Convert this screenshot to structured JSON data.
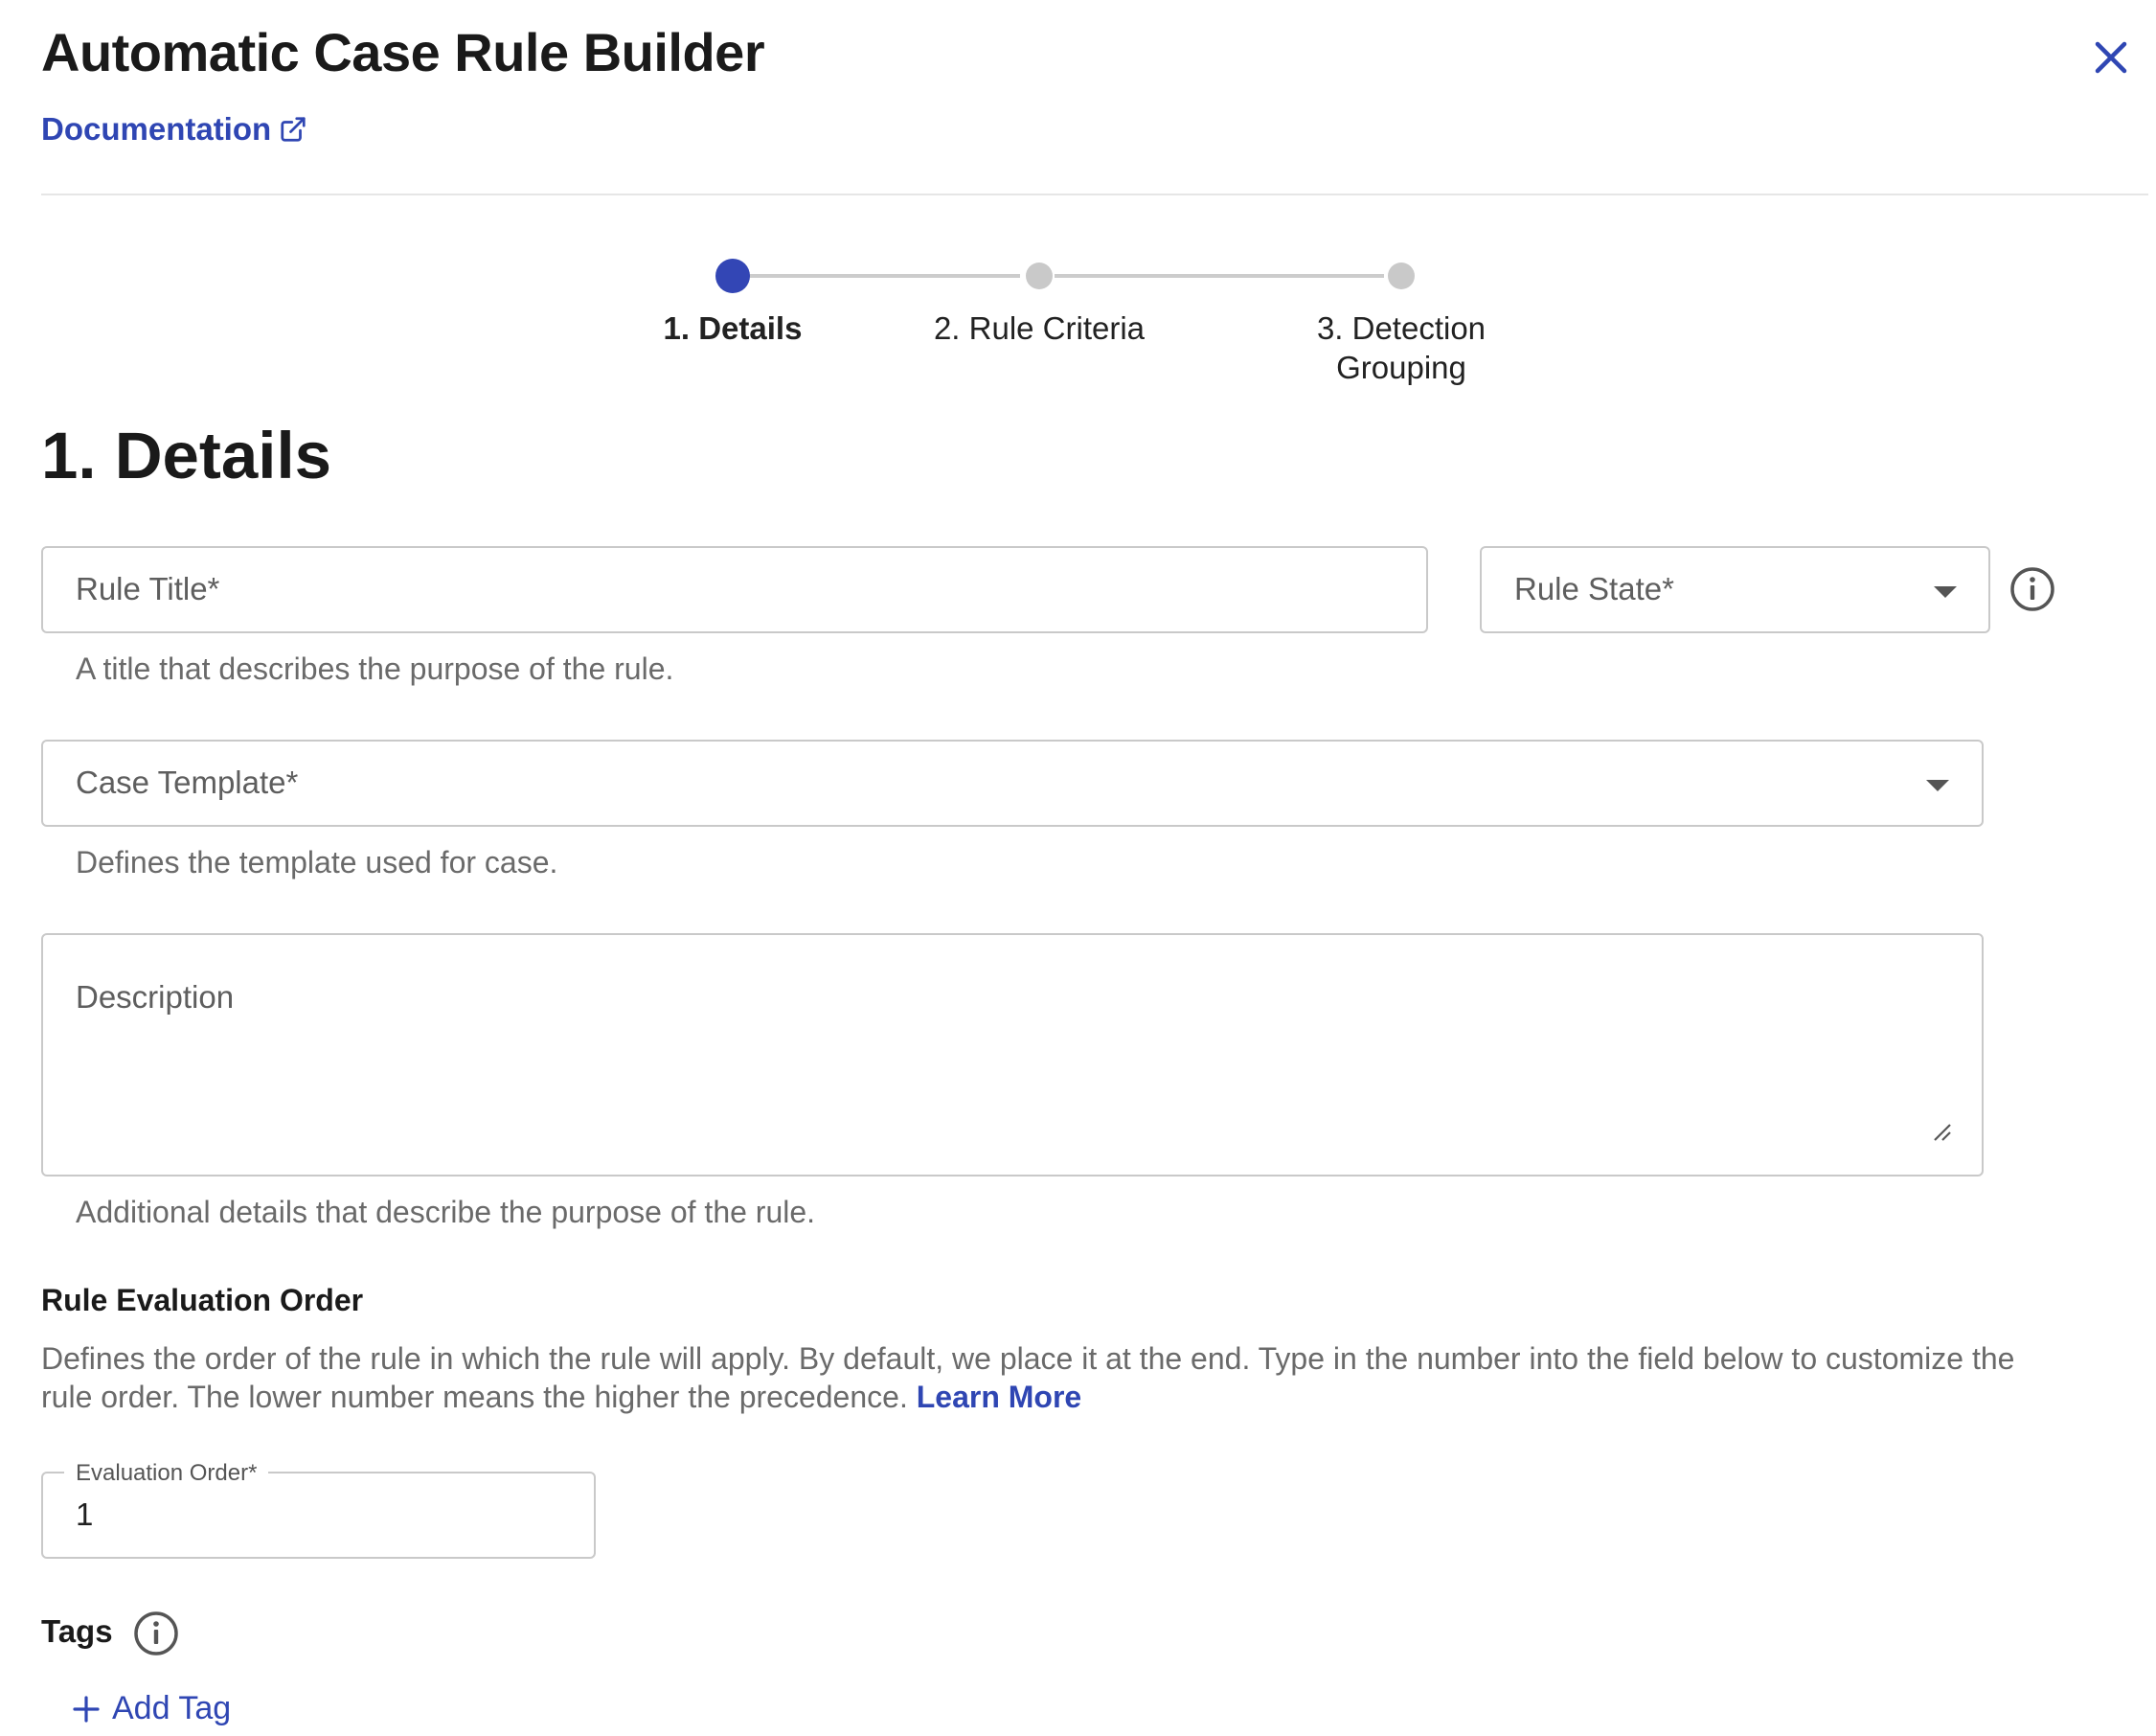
{
  "header": {
    "title": "Automatic Case Rule Builder",
    "documentation_link": "Documentation",
    "close_icon": "close-icon",
    "external_link_icon": "external-link-icon"
  },
  "stepper": {
    "steps": [
      {
        "label": "1. Details",
        "state": "active"
      },
      {
        "label": "2. Rule Criteria",
        "state": "inactive"
      },
      {
        "label_line1": "3. Detection",
        "label_line2": "Grouping",
        "state": "inactive"
      }
    ]
  },
  "section": {
    "heading": "1. Details"
  },
  "form": {
    "rule_title": {
      "placeholder": "Rule Title*",
      "helper": "A title that describes the purpose of the rule."
    },
    "rule_state": {
      "placeholder": "Rule State*",
      "info_icon": "info-icon"
    },
    "case_template": {
      "placeholder": "Case Template*",
      "helper": "Defines the template used for case."
    },
    "description": {
      "placeholder": "Description",
      "helper": "Additional details that describe the purpose of the rule."
    },
    "evaluation": {
      "heading": "Rule Evaluation Order",
      "description_line1": "Defines the order of the rule in which the rule will apply. By default, we place it at the end. Type in the number into the field below to customize the",
      "description_line2": "rule order. The lower number means the higher the precedence.",
      "learn_more": "Learn More",
      "field_label": "Evaluation Order*",
      "field_value": "1"
    },
    "tags": {
      "label": "Tags",
      "info_icon": "info-icon",
      "add_tag": "Add Tag",
      "add_icon": "plus-icon"
    }
  },
  "colors": {
    "accent": "#3346b5",
    "link": "#2f46b3",
    "inactive_step": "#c9c9c9",
    "border": "#c9c9c9",
    "helper_text": "#6a6a6a"
  }
}
